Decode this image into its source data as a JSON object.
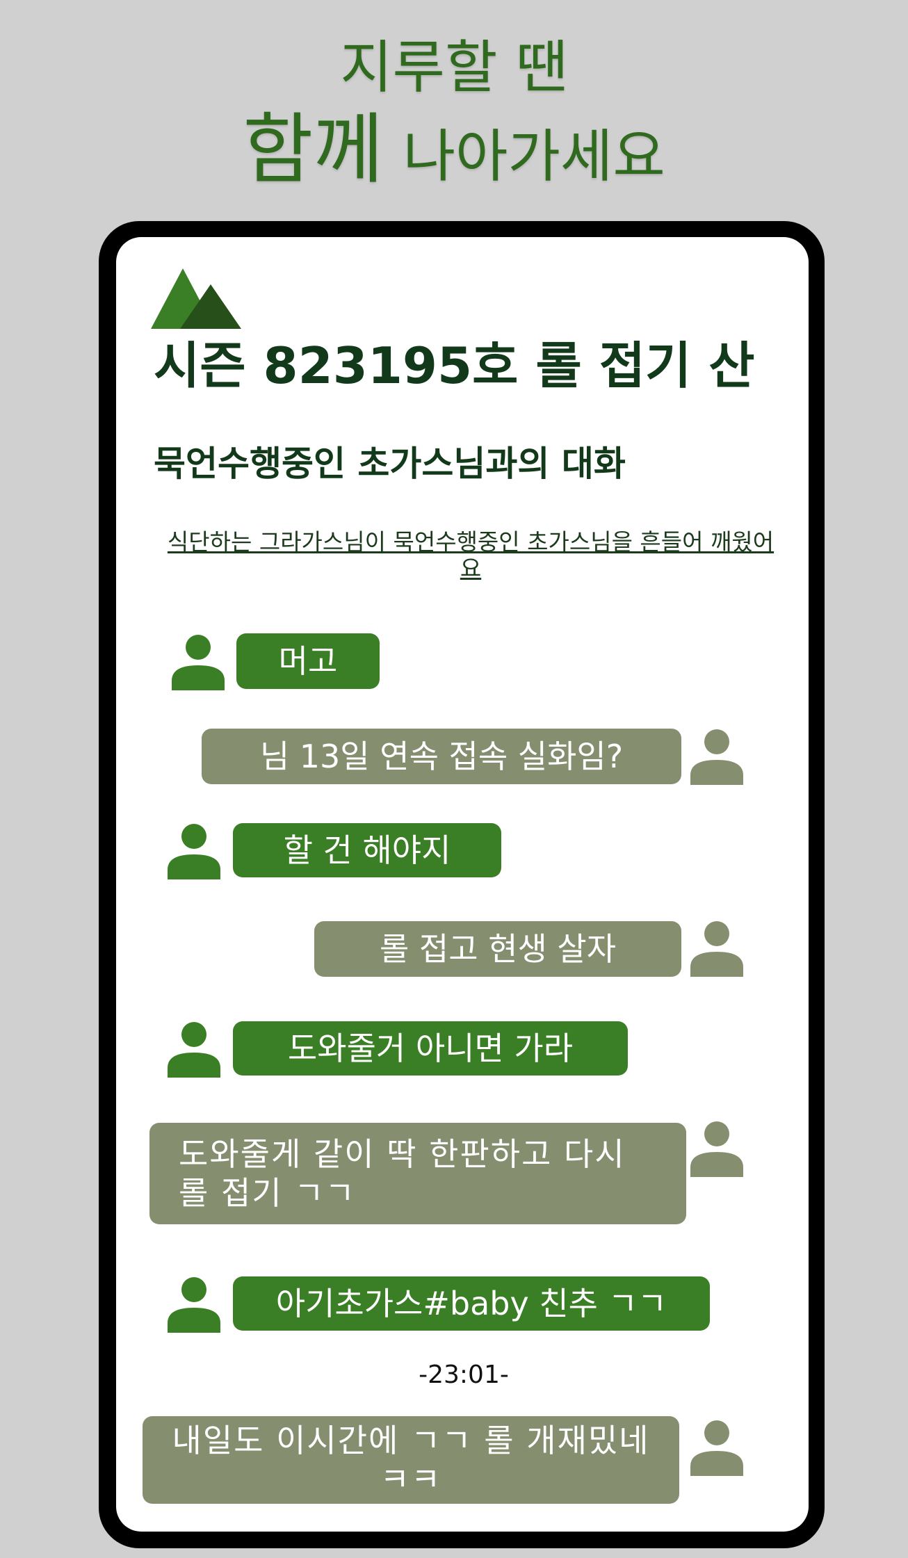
{
  "headline": {
    "line1": "지루할 땐",
    "line2_big": "함께",
    "line2_small": "나아가세요"
  },
  "app": {
    "logo_icon": "mountain-logo-icon",
    "title": "시즌 823195호 롤 접기 산"
  },
  "chat": {
    "title": "묵언수행중인 초가스님과의 대화",
    "notice": "식단하는 그라가스님이 묵언수행중인 초가스님을 흔들어 깨웠어요",
    "timestamp": "-23:01-",
    "messages": [
      {
        "side": "left",
        "text": "머고"
      },
      {
        "side": "right",
        "text": "님 13일 연속 접속 실화임?"
      },
      {
        "side": "left",
        "text": "할 건 해야지"
      },
      {
        "side": "right",
        "text": "롤 접고 현생 살자"
      },
      {
        "side": "left",
        "text": "도와줄거 아니면 가라"
      },
      {
        "side": "right",
        "text": "도와줄게 같이 딱 한판하고 다시 롤 접기 ㄱㄱ"
      },
      {
        "side": "left",
        "text": "아기초가스#baby 친추 ㄱㄱ"
      },
      {
        "side": "right",
        "text": "내일도 이시간에 ㄱㄱ 롤 개재밌네 ㅋㅋ"
      }
    ]
  },
  "colors": {
    "background": "#d0d0d0",
    "headline": "#2f6a1f",
    "title": "#123a1a",
    "bubble_left": "#3a7f25",
    "bubble_right": "#858f70",
    "avatar_left": "#3a7f25",
    "avatar_right": "#858f70"
  }
}
